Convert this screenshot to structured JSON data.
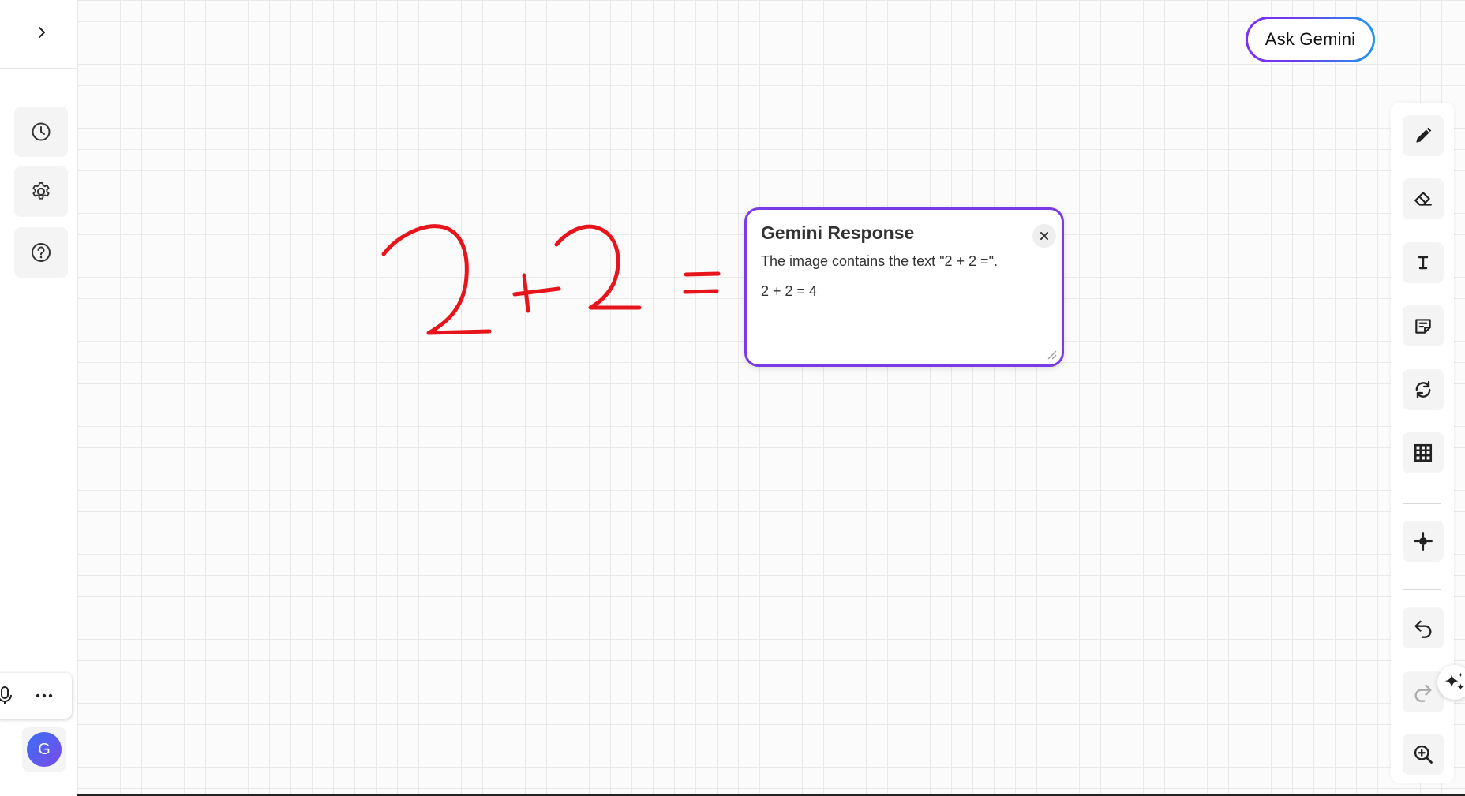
{
  "header": {
    "ask_gemini_label": "Ask Gemini"
  },
  "left_sidebar": {
    "items": [
      {
        "icon": "expand-icon",
        "name": "expand"
      },
      {
        "icon": "history-icon",
        "name": "history"
      },
      {
        "icon": "settings-icon",
        "name": "settings"
      },
      {
        "icon": "help-icon",
        "name": "help"
      }
    ],
    "avatar_initial": "G"
  },
  "gemini_response": {
    "title": "Gemini Response",
    "line1": "The image contains the text \"2 + 2 =\".",
    "line2": "2 + 2 = 4"
  },
  "right_toolbar": {
    "tools": [
      {
        "name": "pen",
        "icon": "pencil-icon"
      },
      {
        "name": "eraser",
        "icon": "eraser-icon"
      },
      {
        "name": "text",
        "icon": "text-icon"
      },
      {
        "name": "sticky-note",
        "icon": "sticky-note-icon"
      },
      {
        "name": "refresh",
        "icon": "refresh-icon"
      },
      {
        "name": "grid",
        "icon": "grid-icon"
      },
      {
        "name": "recenter",
        "icon": "crosshair-icon"
      },
      {
        "name": "undo",
        "icon": "undo-icon"
      },
      {
        "name": "redo",
        "icon": "redo-icon"
      },
      {
        "name": "zoom-in",
        "icon": "zoom-in-icon"
      }
    ]
  },
  "colors": {
    "ink": "#e8141c",
    "accent": "#7a3be6",
    "accent_blue": "#2196f3"
  }
}
